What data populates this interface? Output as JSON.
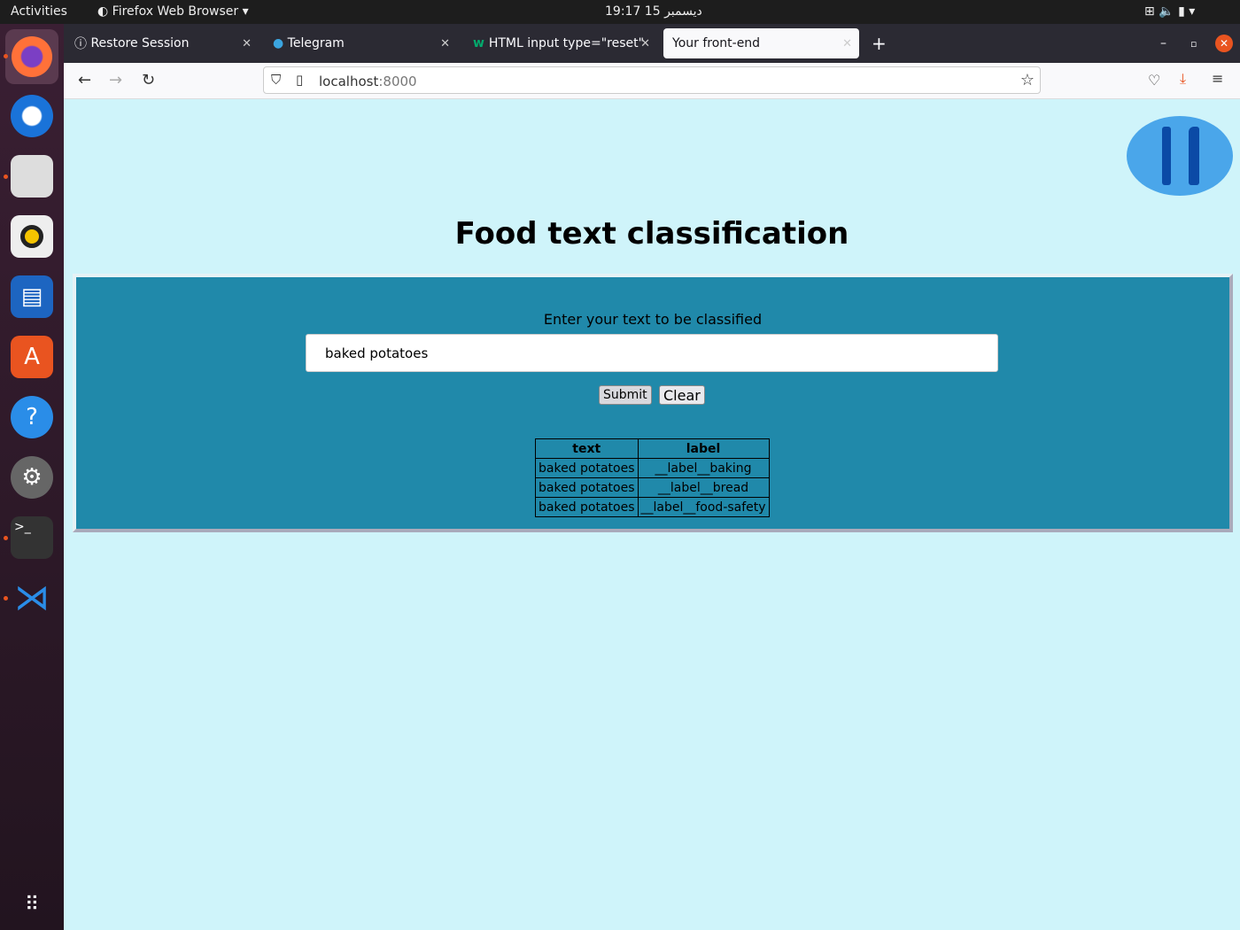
{
  "system": {
    "activities": "Activities",
    "app_menu": "Firefox Web Browser",
    "clock": "19:17  15 ديسمبر"
  },
  "tabs": [
    {
      "label": "Restore Session"
    },
    {
      "label": "Telegram"
    },
    {
      "label": "HTML input type=\"reset\""
    },
    {
      "label": "Your front-end",
      "active": true
    }
  ],
  "nav": {
    "url_host": "localhost",
    "url_port": ":8000"
  },
  "page": {
    "title": "Food text classification",
    "prompt": "Enter your text to be classified",
    "input_value": "baked potatoes",
    "submit": "Submit",
    "clear": "Clear",
    "table": {
      "headers": [
        "text",
        "label"
      ],
      "rows": [
        [
          "baked potatoes",
          "__label__baking"
        ],
        [
          "baked potatoes",
          "__label__bread"
        ],
        [
          "baked potatoes",
          "__label__food-safety"
        ]
      ]
    }
  },
  "colors": {
    "page_bg": "#cff4fa",
    "panel_bg": "#2089aa",
    "accent": "#e95420"
  }
}
